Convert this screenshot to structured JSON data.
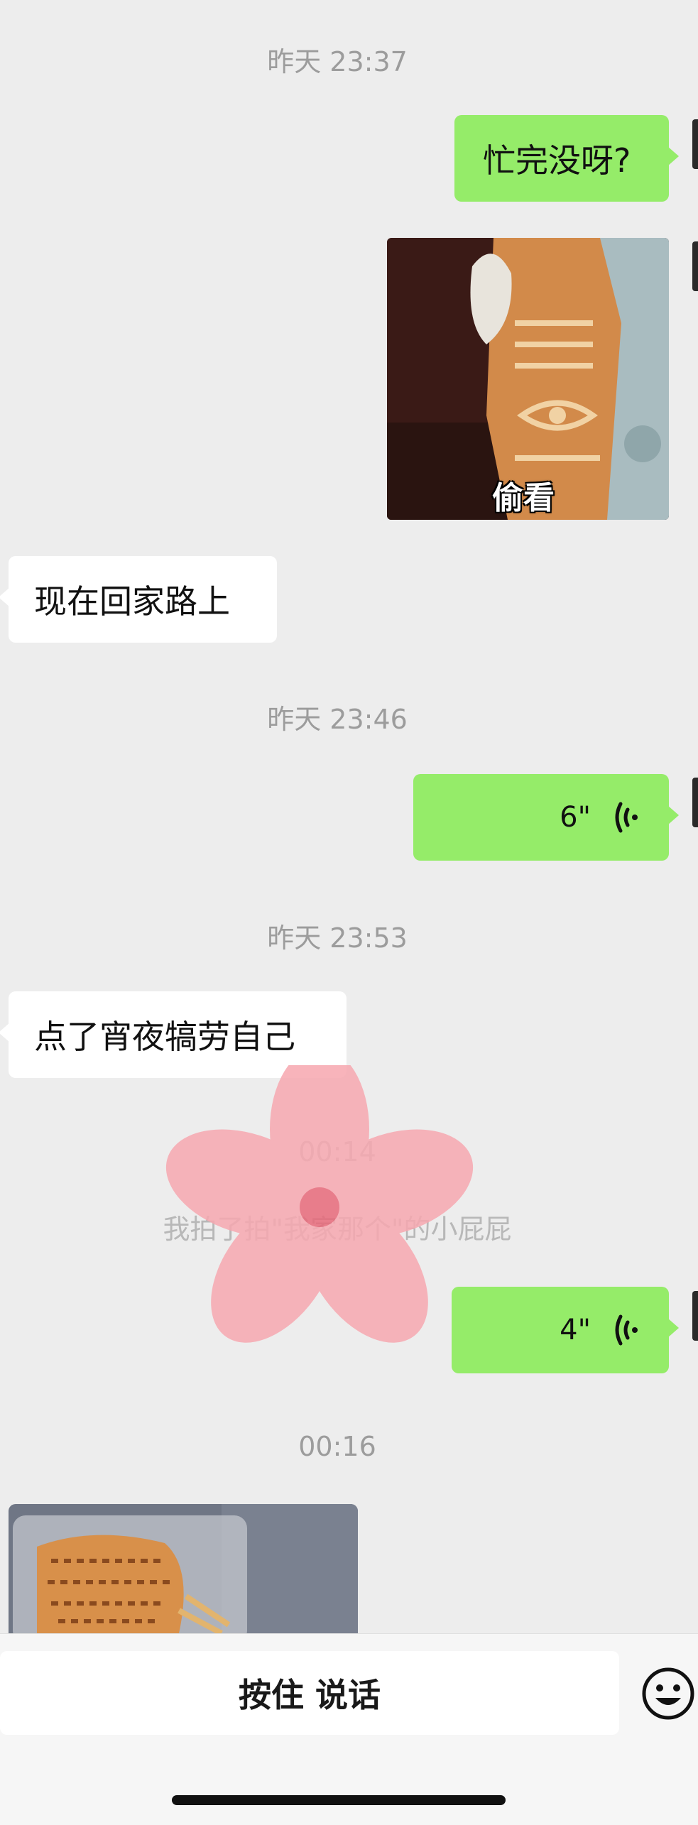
{
  "messages": {
    "ts1": "昨天 23:37",
    "m1_text": "忙完没呀?",
    "sticker_caption": "偷看",
    "m3_text": "现在回家路上",
    "ts2": "昨天 23:46",
    "voice1_duration": "6\"",
    "ts3": "昨天 23:53",
    "m5_text": "点了宵夜犒劳自己",
    "system_time": "00:14",
    "system_text": "我拍了拍\"我家那个\"的小屁屁",
    "voice2_duration": "4\"",
    "ts4": "00:16"
  },
  "input_bar": {
    "talk_label": "按住 说话",
    "emoji_icon": "smiley-icon"
  },
  "colors": {
    "background": "#ededed",
    "outgoing_bubble": "#95ec69",
    "incoming_bubble": "#ffffff",
    "timestamp": "#9c9c9c"
  }
}
